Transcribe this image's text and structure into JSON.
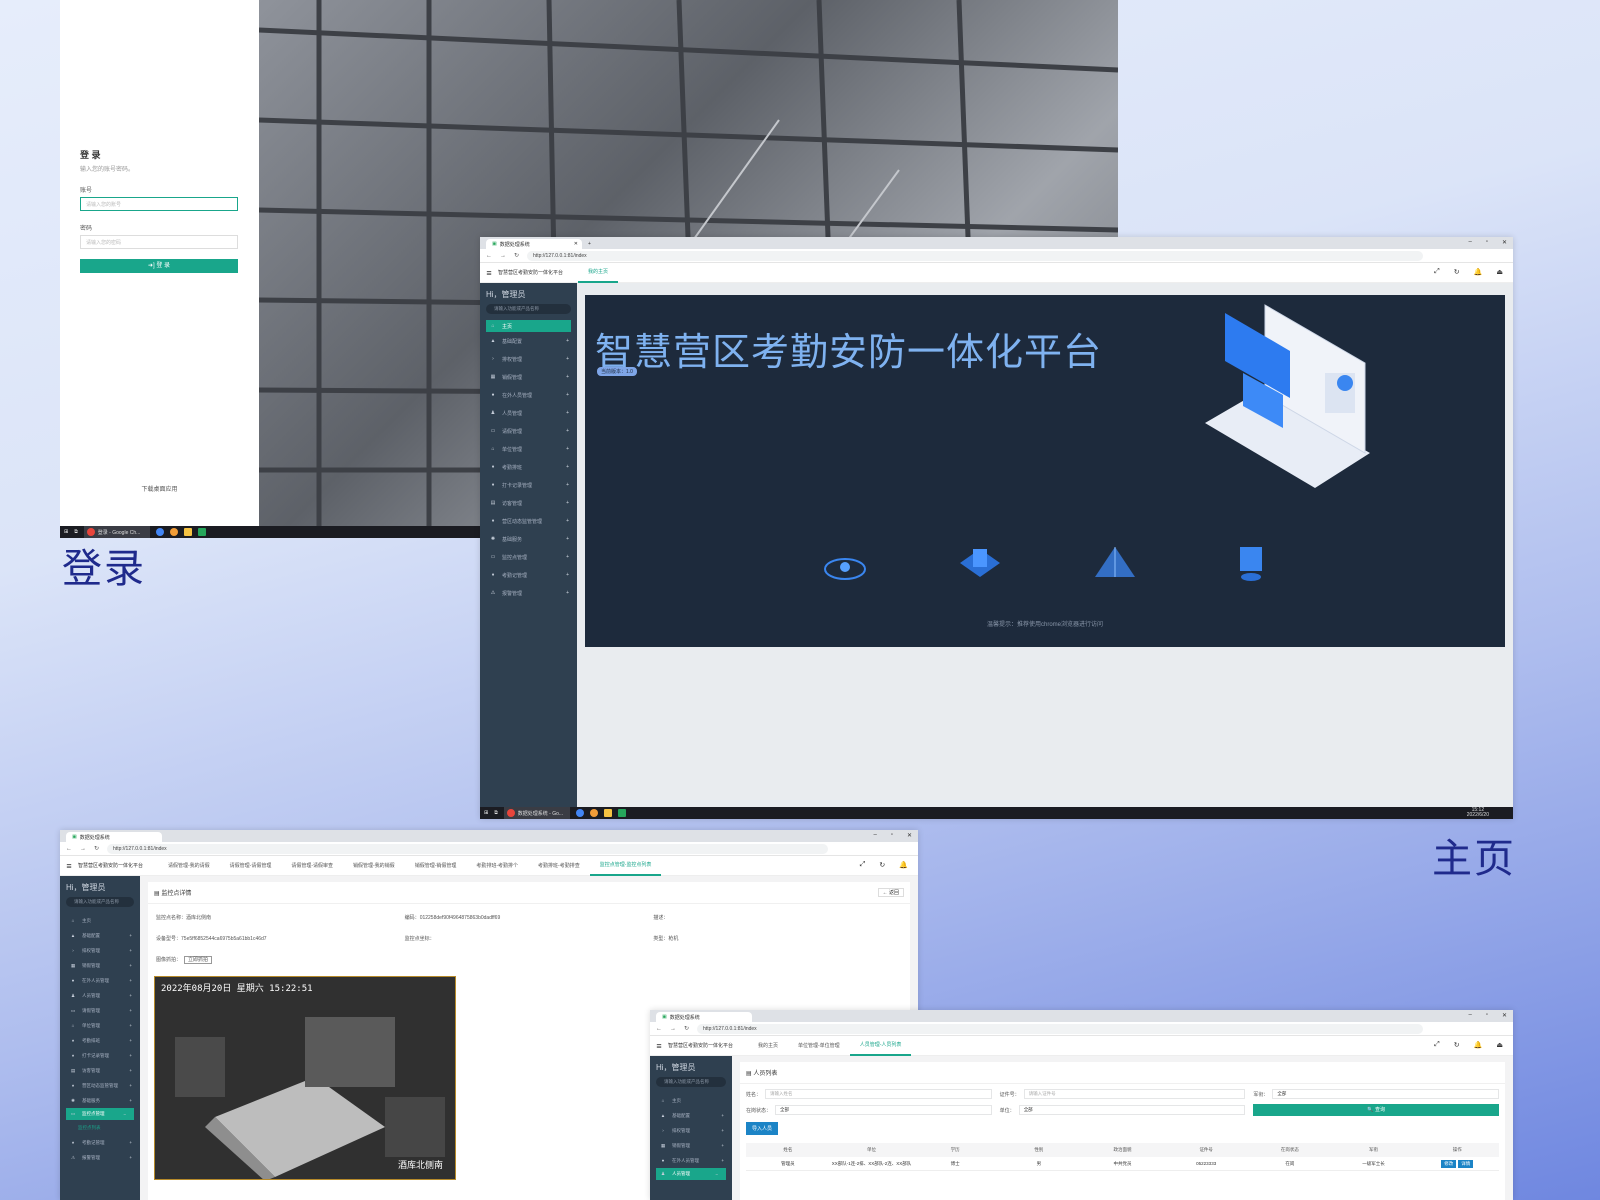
{
  "captions": {
    "login": "登录",
    "main": "主页"
  },
  "login": {
    "title": "登 录",
    "subtitle": "输入您的账号密码。",
    "account_label": "账号",
    "account_placeholder": "请输入您的账号",
    "password_label": "密码",
    "password_placeholder": "请输入您的密码",
    "login_button": "➜] 登 录",
    "download": "下载桌面应用",
    "taskbar_tab": "登录 - Google Ch..."
  },
  "browser": {
    "tab_title": "数据处理系统",
    "url": "http://127.0.0.1:81/index",
    "app_title": "智慧营区考勤安防一体化平台"
  },
  "sidebar": {
    "greeting": "Hi，管理员",
    "search_placeholder": "请输入功能或产品名称",
    "items": [
      "主页",
      "基础配置",
      "排权管理",
      "销假管理",
      "在外人员管理",
      "人员管理",
      "请假管理",
      "单位管理",
      "考勤排班",
      "打卡记录管理",
      "访客管理",
      "营区动态监管管理",
      "基础服务",
      "监控点管理",
      "考勤记管理",
      "报警管理"
    ],
    "sub_item": "监控点列表"
  },
  "main": {
    "tab_home": "我的主页",
    "hero_title": "智慧营区考勤安防一体化平台",
    "version": "当前版本：1.0",
    "tip": "温馨提示：推荐使用chrome浏览器进行访问",
    "taskbar_tab": "数据处理系统 - Go...",
    "clock_time": "15:12",
    "clock_date": "2022/6/20"
  },
  "monitor": {
    "tabs": [
      "请假管理-我的请假",
      "请假管理-请假管理",
      "请假管理-请假审查",
      "销假管理-我的销假",
      "销假管理-销假管理",
      "考勤排班-考勤排个",
      "考勤排班-考勤排查",
      "打卡记录管理-打卡记录管理",
      "访客管理-访客管理",
      "访客管理-单位管理",
      "监控点管理-监控点列表"
    ],
    "title": "监控点详情",
    "back": "← 返回",
    "name_label": "监控点名称：",
    "name_value": "酒库北侧南",
    "code_label": "编码：",
    "code_value": "012258def90f4964875863b0dadff69",
    "addr_label": "描述：",
    "device_label": "设备型号：",
    "device_value": "75e5ff6852544ca6975b5a61bb1c46d7",
    "coord_label": "监控点坐标：",
    "type_label": "类型：",
    "type_value": "枪机",
    "ptz_label": "图像抓拍：",
    "ptz_btn": "立即抓拍",
    "cam_time": "2022年08月20日 星期六 15:22:51",
    "cam_location": "酒库北侧南"
  },
  "people": {
    "tabs": [
      "我的主页",
      "单位管理-单位管理",
      "人员管理-人员列表"
    ],
    "title": "人员列表",
    "f_name": "姓名：",
    "f_name_ph": "请输入姓名",
    "f_id": "证件号：",
    "f_id_ph": "请输入证件号",
    "f_rank": "军衔：",
    "f_rank_val": "全部",
    "f_status": "在岗状态：",
    "f_status_val": "全部",
    "f_unit": "单位：",
    "f_unit_val": "全部",
    "query": "🔍 查询",
    "import": "导入人员",
    "columns": [
      "姓名",
      "单位",
      "学历",
      "性别",
      "政治面貌",
      "证件号",
      "在岗状态",
      "军衔",
      "操作"
    ],
    "row": [
      "管理员",
      "XX部队-1连-2排、XX部队-2连、XX部队",
      "博士",
      "男",
      "中共党员",
      "05223333",
      "在岗",
      "一级军士长",
      ""
    ],
    "ops": [
      "修改",
      "详情"
    ]
  }
}
